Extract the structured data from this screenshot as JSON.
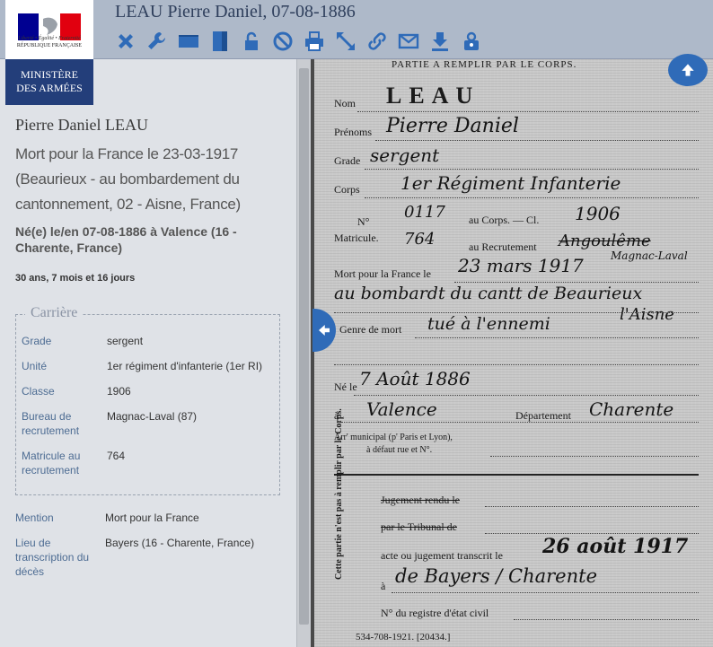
{
  "window": {
    "title": "LEAU Pierre Daniel, 07-08-1886"
  },
  "logo": {
    "motto": "Liberté • Égalité • Fraternité",
    "republic": "RÉPUBLIQUE FRANÇAISE",
    "ministry_line1": "MINISTÈRE",
    "ministry_line2": "DES ARMÉES"
  },
  "toolbar": {
    "icons": [
      "close-icon",
      "wrench-icon",
      "horizontal-layout-icon",
      "vertical-layout-icon",
      "lock-icon",
      "forbidden-icon",
      "print-icon",
      "expand-icon",
      "link-icon",
      "mail-icon",
      "download-icon",
      "lock-user-icon"
    ],
    "accent": "#2f6bb8"
  },
  "person": {
    "name": "Pierre Daniel LEAU",
    "death": "Mort pour la France le 23-03-1917 (Beaurieux - au bombardement du cantonnement, 02 - Aisne, France)",
    "birth": "Né(e) le/en 07-08-1886 à Valence (16 - Charente, France)",
    "age": "30 ans, 7 mois et 16 jours"
  },
  "career": {
    "legend": "Carrière",
    "rows": [
      {
        "label": "Grade",
        "value": "sergent"
      },
      {
        "label": "Unité",
        "value": "1er régiment d'infanterie (1er RI)"
      },
      {
        "label": "Classe",
        "value": "1906"
      },
      {
        "label": "Bureau de recrutement",
        "value": "Magnac-Laval (87)"
      },
      {
        "label": "Matricule au recrutement",
        "value": "764"
      }
    ]
  },
  "extra": [
    {
      "label": "Mention",
      "value": "Mort pour la France"
    },
    {
      "label": "Lieu de transcription du décès",
      "value": "Bayers (16 - Charente, France)"
    }
  ],
  "document": {
    "header": "PARTIE A REMPLIR PAR LE CORPS.",
    "fields": {
      "nom": "Nom",
      "nom_value": "LEAU",
      "prenoms": "Prénoms",
      "prenoms_value": "Pierre Daniel",
      "grade": "Grade",
      "grade_value": "sergent",
      "corps": "Corps",
      "corps_value": "1er Régiment Infanterie",
      "no": "N°",
      "matricule": "Matricule.",
      "au_corps": "au Corps. — Cl.",
      "au_corps_value": "0117",
      "classe_value": "1906",
      "au_recrutement": "au Recrutement",
      "recrutement_value": "764",
      "recrutement_place": "Angoulême",
      "recrutement_place2": "Magnac-Laval",
      "mort": "Mort pour la France le",
      "mort_value": "23 mars 1917",
      "mort_place": "au bombardt du cantt de Beaurieux",
      "mort_dept": "l'Aisne",
      "genre": "Genre de mort",
      "genre_value": "tué à l'ennemi",
      "ne": "Né le",
      "ne_value": "7 Août 1886",
      "a": "à",
      "a_value": "Valence",
      "departement": "Département",
      "departement_value": "Charente",
      "arr1": "Arr' municipal (p' Paris et Lyon),",
      "arr2": "à défaut rue et N°.",
      "side_note": "Cette partie n'est pas à remplir par le Corps.",
      "jugement": "Jugement rendu le",
      "tribunal": "par le Tribunal de",
      "acte": "acte ou jugement transcrit le",
      "acte_value": "26 août 1917",
      "a2": "à",
      "a2_value": "de Bayers / Charente",
      "registre": "N° du registre d'état civil",
      "footer": "534-708-1921. [20434.]"
    }
  }
}
